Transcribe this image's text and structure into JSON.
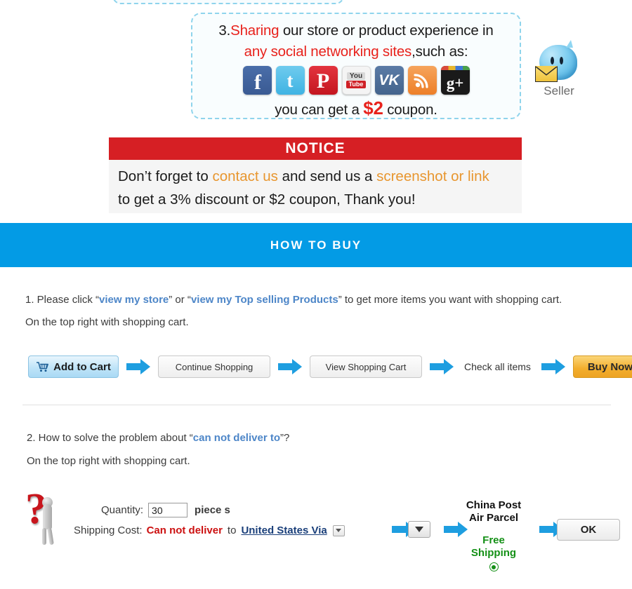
{
  "promo": {
    "number": "3.",
    "sharing_word": "Sharing",
    "line1_rest": " our store or product experience in",
    "line2_red": "any social networking sites",
    "line2_rest": ",such as:",
    "line3_pre": "you can get a ",
    "line3_amount": "$2",
    "line3_post": " coupon.",
    "icons": [
      {
        "name": "facebook-icon",
        "glyph": "f"
      },
      {
        "name": "twitter-icon",
        "glyph": "t"
      },
      {
        "name": "pinterest-icon",
        "glyph": "P"
      },
      {
        "name": "youtube-icon",
        "glyph_top": "You",
        "glyph_bottom": "Tube"
      },
      {
        "name": "vk-icon",
        "glyph": "VK"
      },
      {
        "name": "rss-blog-icon",
        "glyph": "ɓ"
      },
      {
        "name": "google-plus-icon",
        "glyph": "g+"
      }
    ]
  },
  "seller": {
    "label": "Seller",
    "icon_name": "seller-message-icon"
  },
  "notice": {
    "title": "NOTICE",
    "line1_a": "Don’t forget to ",
    "line1_link1": "contact us",
    "line1_b": " and send us a ",
    "line1_link2": "screenshot or link",
    "line2": "to get a 3% discount or $2 coupon, Thank you!",
    "bar_color": "#d61f24",
    "link_color": "#e8962f"
  },
  "banner": {
    "title": "HOW TO BUY",
    "bg_color": "#039be5"
  },
  "step1": {
    "line1_a": "1. Please click “",
    "line1_link1": "view my store",
    "line1_b": "” or “",
    "line1_link2": "view my Top selling Products",
    "line1_c": "” to get more items you want with shopping cart.",
    "line2": "On the top right with shopping cart."
  },
  "flow": {
    "add_to_cart": "Add to Cart",
    "continue_shopping": "Continue Shopping",
    "view_shopping_cart": "View Shopping Cart",
    "check_all_items": "Check all items",
    "buy_now": "Buy Now",
    "cart_icon": "shopping-cart-icon",
    "arrow_color": "#1e9ee0"
  },
  "step2": {
    "line1_a": "2. How to solve the problem about “",
    "line1_link": "can not deliver to",
    "line1_b": "”?",
    "line2": "On the top right with shopping cart."
  },
  "form": {
    "quantity_label": "Quantity:",
    "quantity_value": "30",
    "quantity_unit": "piece s",
    "shipping_label": "Shipping Cost:",
    "cannot_deliver": "Can not deliver",
    "to_word": "to",
    "destination": "United States Via",
    "shipping_name_line1": "China Post",
    "shipping_name_line2": "Air Parcel",
    "free_line1": "Free",
    "free_line2": "Shipping",
    "ok_label": "OK",
    "free_color": "#149016",
    "error_color": "#cc1111"
  }
}
